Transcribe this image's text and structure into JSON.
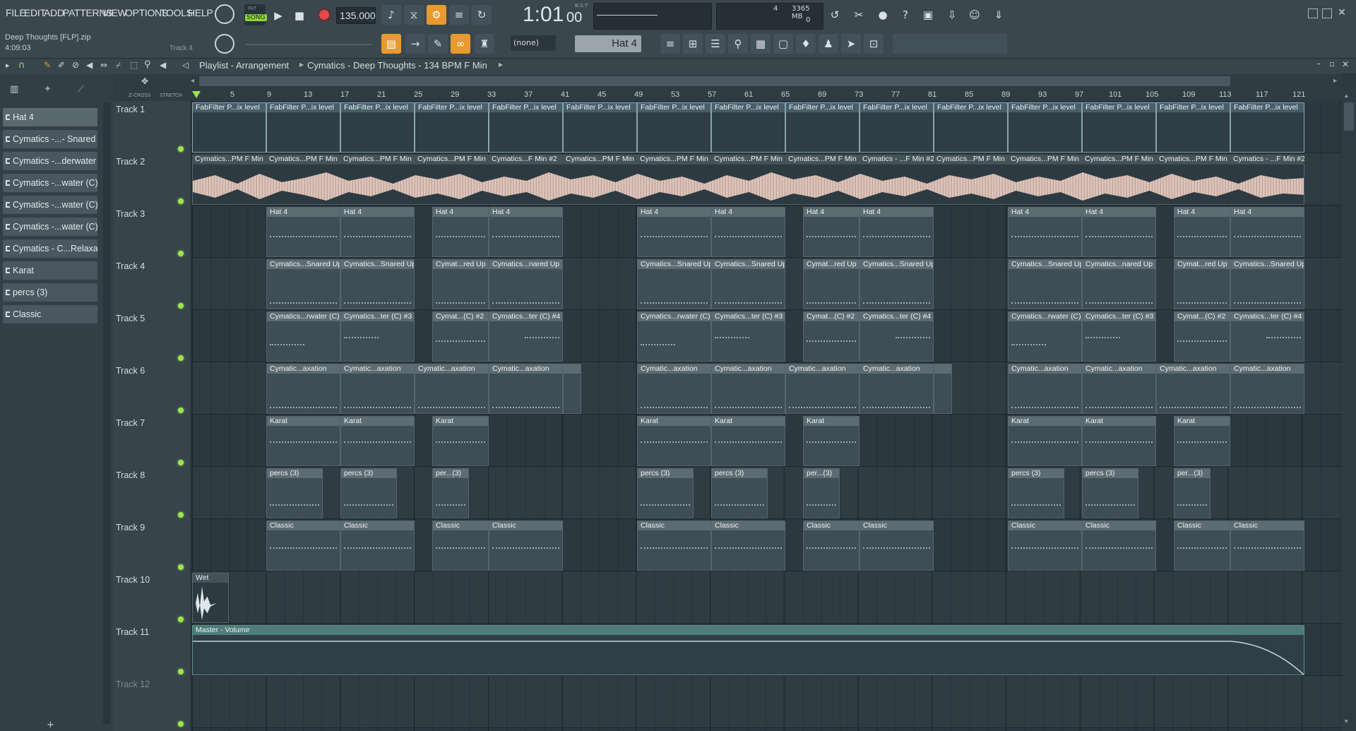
{
  "menu": [
    "FILE",
    "EDIT",
    "ADD",
    "PATTERNS",
    "VIEW",
    "OPTIONS",
    "TOOLS",
    "HELP"
  ],
  "transport": {
    "mode": "SONG",
    "pat_label": "PAT",
    "tempo": "135.000",
    "time": "1:01",
    "time_ticks": "00",
    "time_label": "B:S:T"
  },
  "cpu": {
    "value": "4",
    "memory": "3365 MB",
    "polyphony": "0"
  },
  "project": {
    "file": "Deep Thoughts [FLP].zip",
    "duration": "4:09:03",
    "hint": "Track 4"
  },
  "pattern": {
    "selected": "Hat 4",
    "snap": "(none)"
  },
  "playlist": {
    "breadcrumb": [
      "Playlist - Arrangement",
      "Cymatics - Deep Thoughts - 134 BPM F Min"
    ]
  },
  "options": {
    "zcross": "Z-CROSS",
    "stretch": "STRETCH"
  },
  "picker": [
    "Hat 4",
    "Cymatics -...- Snared Up",
    "Cymatics -...derwater (C)",
    "Cymatics -...water (C) #4",
    "Cymatics -...water (C) #3",
    "Cymatics -...water (C) #2",
    "Cymatics - C...Relaxation",
    "Karat",
    "percs (3)",
    "Classic"
  ],
  "ruler": [
    "5",
    "9",
    "13",
    "17",
    "21",
    "25",
    "29",
    "33",
    "37",
    "41",
    "45",
    "49",
    "53",
    "57",
    "61",
    "65",
    "69",
    "73",
    "77",
    "81",
    "85",
    "89",
    "93",
    "97",
    "101",
    "105",
    "109",
    "113",
    "117",
    "121"
  ],
  "tracks": [
    "Track 1",
    "Track 2",
    "Track 3",
    "Track 4",
    "Track 5",
    "Track 6",
    "Track 7",
    "Track 8",
    "Track 9",
    "Track 10",
    "Track 11",
    "Track 12"
  ],
  "clips": {
    "t1": "FabFilter P...ix level",
    "t2a": "Cymatics...PM F Min",
    "t2b": "Cymatics...F Min #2",
    "t2c": "Cymatics - ...F Min #2",
    "t3": "Hat 4",
    "t4a": "Cymatics...Snared Up",
    "t4b": "Cymat...red Up",
    "t4c": "Cymatics...nared Up",
    "t5a": "Cymatics...rwater (C)",
    "t5b": "Cymatics...ter (C) #3",
    "t5c": "Cymat...(C) #2",
    "t5d": "Cymatics...ter (C) #4",
    "t6": "Cymatic...axation",
    "t7": "Karat",
    "t8": "percs (3)",
    "t8b": "per...(3)",
    "t9": "Classic",
    "t10": "Wet",
    "t11": "Master - Volume"
  },
  "colors": {
    "accent": "#e79a2f",
    "led": "#9be64a",
    "grid": "#2b3840"
  }
}
